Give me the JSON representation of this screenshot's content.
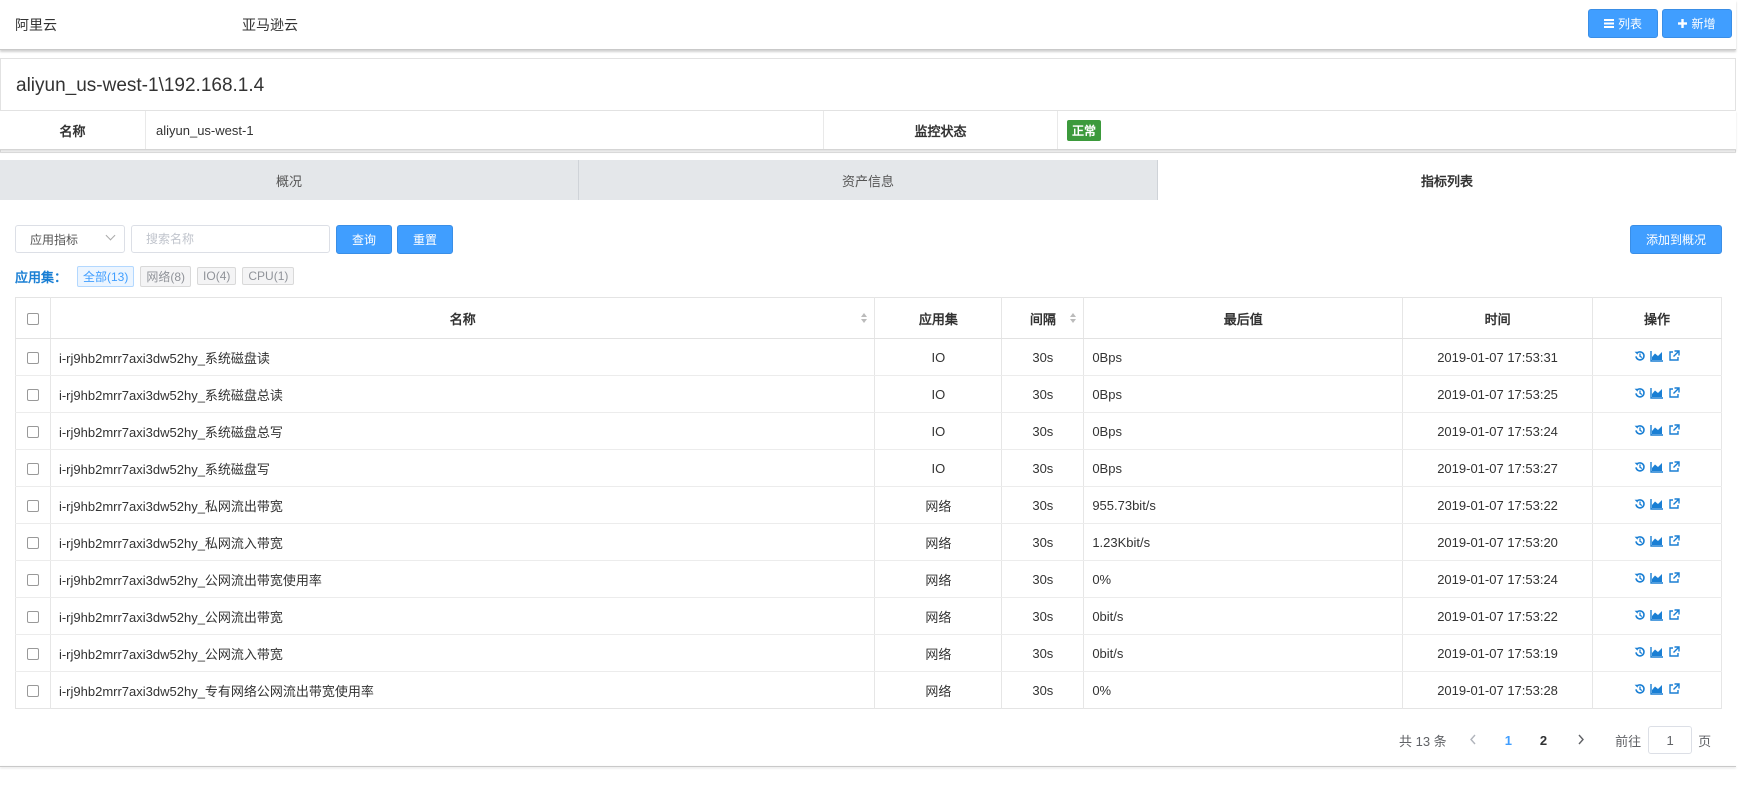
{
  "topbar": {
    "clouds": [
      "阿里云",
      "亚马逊云"
    ],
    "list_label": "列表",
    "add_label": "新增"
  },
  "page_title": "aliyun_us-west-1\\192.168.1.4",
  "info": {
    "name_label": "名称",
    "name_value": "aliyun_us-west-1",
    "status_label": "监控状态",
    "status_value": "正常",
    "status_color": "#3c9a3c"
  },
  "tabs": [
    "概况",
    "资产信息",
    "指标列表"
  ],
  "active_tab": 2,
  "filters": {
    "select_value": "应用指标",
    "search_placeholder": "搜索名称",
    "query_label": "查询",
    "reset_label": "重置",
    "add_overview_label": "添加到概况"
  },
  "appset": {
    "label": "应用集：",
    "chips": [
      "全部(13)",
      "网络(8)",
      "IO(4)",
      "CPU(1)"
    ]
  },
  "table": {
    "headers": [
      "名称",
      "应用集",
      "间隔",
      "最后值",
      "时间",
      "操作"
    ],
    "rows": [
      {
        "name": "i-rj9hb2mrr7axi3dw52hy_系统磁盘读",
        "set": "IO",
        "interval": "30s",
        "last": "0Bps",
        "time": "2019-01-07 17:53:31"
      },
      {
        "name": "i-rj9hb2mrr7axi3dw52hy_系统磁盘总读",
        "set": "IO",
        "interval": "30s",
        "last": "0Bps",
        "time": "2019-01-07 17:53:25"
      },
      {
        "name": "i-rj9hb2mrr7axi3dw52hy_系统磁盘总写",
        "set": "IO",
        "interval": "30s",
        "last": "0Bps",
        "time": "2019-01-07 17:53:24"
      },
      {
        "name": "i-rj9hb2mrr7axi3dw52hy_系统磁盘写",
        "set": "IO",
        "interval": "30s",
        "last": "0Bps",
        "time": "2019-01-07 17:53:27"
      },
      {
        "name": "i-rj9hb2mrr7axi3dw52hy_私网流出带宽",
        "set": "网络",
        "interval": "30s",
        "last": "955.73bit/s",
        "time": "2019-01-07 17:53:22"
      },
      {
        "name": "i-rj9hb2mrr7axi3dw52hy_私网流入带宽",
        "set": "网络",
        "interval": "30s",
        "last": "1.23Kbit/s",
        "time": "2019-01-07 17:53:20"
      },
      {
        "name": "i-rj9hb2mrr7axi3dw52hy_公网流出带宽使用率",
        "set": "网络",
        "interval": "30s",
        "last": "0%",
        "time": "2019-01-07 17:53:24"
      },
      {
        "name": "i-rj9hb2mrr7axi3dw52hy_公网流出带宽",
        "set": "网络",
        "interval": "30s",
        "last": "0bit/s",
        "time": "2019-01-07 17:53:22"
      },
      {
        "name": "i-rj9hb2mrr7axi3dw52hy_公网流入带宽",
        "set": "网络",
        "interval": "30s",
        "last": "0bit/s",
        "time": "2019-01-07 17:53:19"
      },
      {
        "name": "i-rj9hb2mrr7axi3dw52hy_专有网络公网流出带宽使用率",
        "set": "网络",
        "interval": "30s",
        "last": "0%",
        "time": "2019-01-07 17:53:28"
      }
    ],
    "row_actions": [
      "history-icon",
      "area-chart-icon",
      "external-link-icon"
    ]
  },
  "pagination": {
    "total": "共 13 条",
    "pages": [
      "1",
      "2"
    ],
    "current": "1",
    "goto_label": "前往",
    "goto_value": "1",
    "page_suffix": "页"
  },
  "colors": {
    "primary": "#409eff",
    "link": "#1a7fd4"
  }
}
